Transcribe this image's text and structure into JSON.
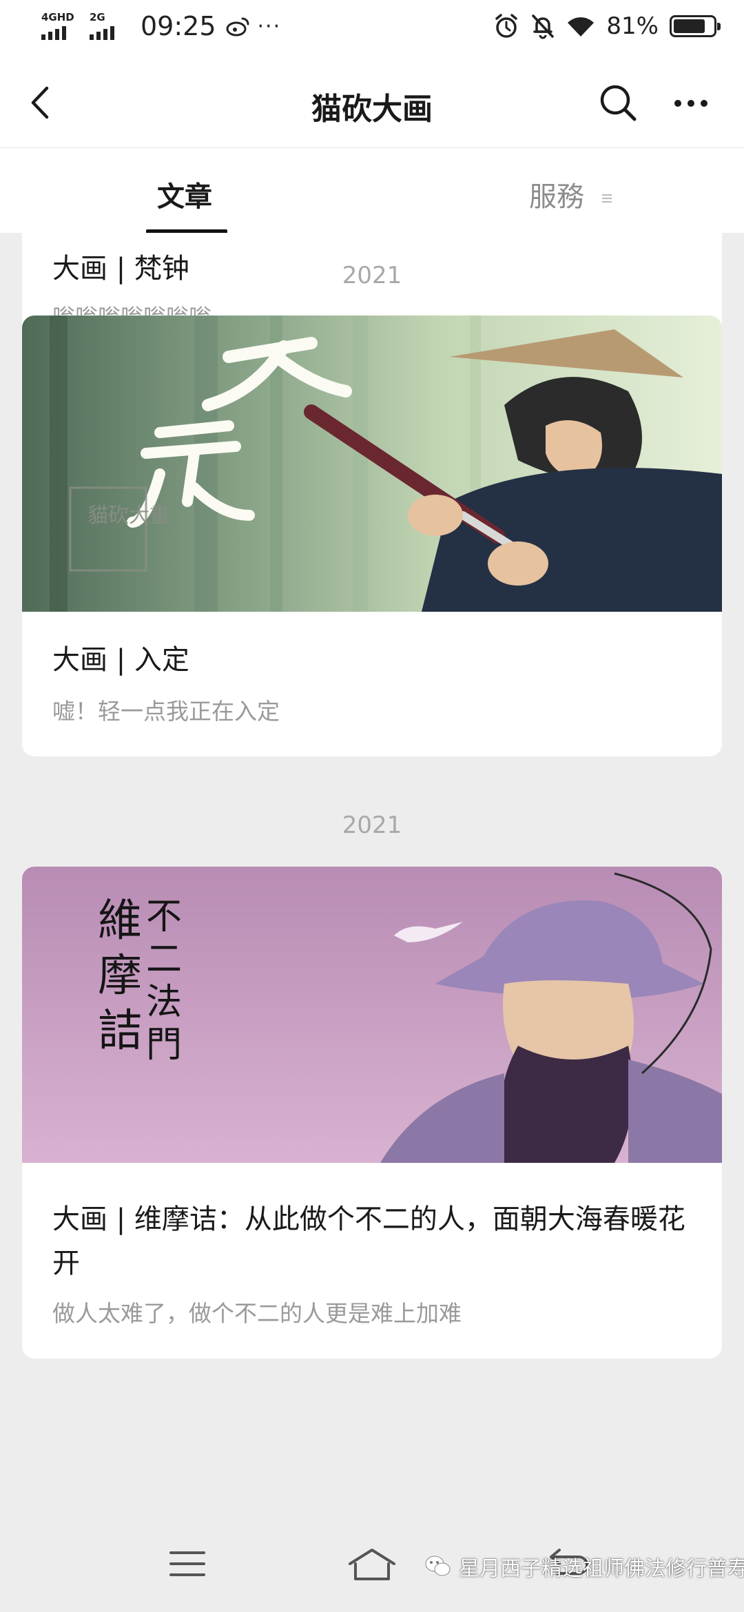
{
  "status_bar": {
    "network_1": "4GHD",
    "network_2": "2G",
    "time": "09:25",
    "more": "···",
    "battery_percent": "81%",
    "battery_level": 0.81,
    "icons": [
      "weibo-icon",
      "alarm-icon",
      "mute-bell-icon",
      "wifi-icon",
      "battery-icon"
    ]
  },
  "header": {
    "title": "猫砍大画",
    "back_icon": "chevron-left-icon",
    "search_icon": "search-icon",
    "more_icon": "more-dots-icon"
  },
  "tabs": [
    {
      "label": "文章",
      "active": true
    },
    {
      "label": "服務",
      "active": false
    }
  ],
  "articles": [
    {
      "title": "大画 | 梵钟",
      "summary": "嗡嗡嗡嗡嗡嗡嗡"
    },
    {
      "year": "2021",
      "title": "大画 | 入定",
      "summary": "嘘！轻一点我正在入定",
      "cover_text": "入定",
      "cover_seal": "貓砍大畫"
    },
    {
      "year": "2021",
      "title": "大画 | 维摩诘：从此做个不二的人，面朝大海春暖花开",
      "summary": "做人太难了，做个不二的人更是难上加难",
      "cover_text_1": "維摩詰",
      "cover_text_2": "不二法門"
    }
  ],
  "bottom_nav": {
    "icons": [
      "menu-icon",
      "home-icon",
      "return-icon"
    ],
    "watermark": "星月西子精选祖师佛法修行普寿"
  },
  "colors": {
    "background": "#ededed",
    "card": "#ffffff",
    "text_primary": "#1a1a1a",
    "text_secondary": "#9a9a9a",
    "year_label": "#a8a8a8"
  }
}
